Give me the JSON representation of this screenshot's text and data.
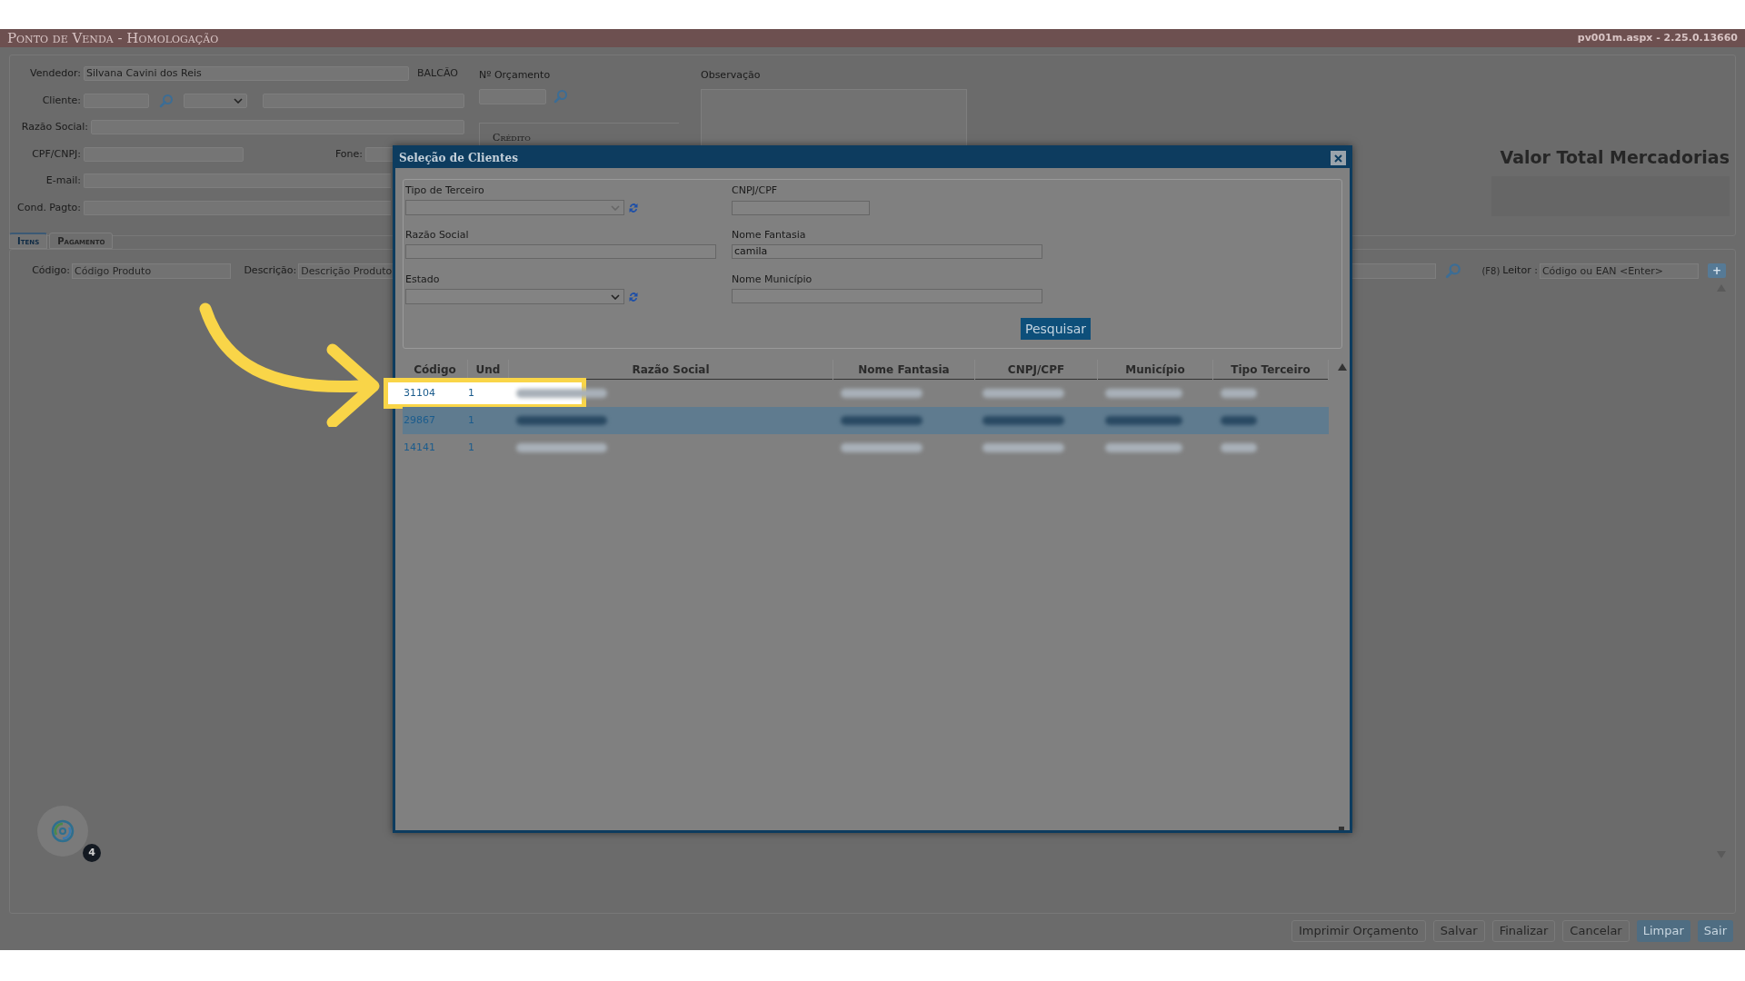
{
  "app_header": {
    "title": "Ponto de Venda  - Homologação",
    "version": "pv001m.aspx - 2.25.0.13660"
  },
  "order_form": {
    "vendedor_label": "Vendedor:",
    "vendedor_value": "Silvana Cavini dos Reis",
    "balcao": "BALCÃO",
    "cliente_label": "Cliente:",
    "razao_social_label": "Razão Social:",
    "cpf_label": "CPF/CNPJ:",
    "fone_label": "Fone:",
    "email_label": "E-mail:",
    "cond_pagto_label": "Cond. Pagto:",
    "orcamento_label": "Nº Orçamento",
    "credito_label": "Crédito",
    "observacao_label": "Observação"
  },
  "total": {
    "label": "Valor Total Mercadorias"
  },
  "tabs": [
    {
      "label": "Itens",
      "selected": true
    },
    {
      "label": "Pagamento",
      "selected": false
    }
  ],
  "item_entry": {
    "codigo_label": "Código:",
    "codigo_placeholder": "Código Produto",
    "descricao_label": "Descrição:",
    "descricao_placeholder": "Descrição Produto",
    "leitor_hint": "(F8)",
    "leitor_label": "Leitor :",
    "leitor_placeholder": "Código ou EAN <Enter>",
    "add_button": "+"
  },
  "actions": [
    {
      "label": "Imprimir Orçamento",
      "disabled": true
    },
    {
      "label": "Salvar",
      "disabled": true
    },
    {
      "label": "Finalizar",
      "disabled": true
    },
    {
      "label": "Cancelar",
      "disabled": true
    },
    {
      "label": "Limpar",
      "disabled": false
    },
    {
      "label": "Sair",
      "disabled": false
    }
  ],
  "help_badge": {
    "count": "4"
  },
  "dialog": {
    "title": "Seleção de Clientes",
    "filters": {
      "tipo_label": "Tipo de Terceiro",
      "cnpj_label": "CNPJ/CPF",
      "razao_label": "Razão Social",
      "fantasia_label": "Nome Fantasia",
      "fantasia_value": "camila",
      "estado_label": "Estado",
      "municipio_label": "Nome Município"
    },
    "search_button": "Pesquisar",
    "columns": [
      "Código",
      "Und",
      "Razão Social",
      "Nome Fantasia",
      "CNPJ/CPF",
      "Município",
      "Tipo Terceiro"
    ],
    "rows": [
      {
        "codigo": "31104",
        "und": "1",
        "selected": false,
        "highlighted": true
      },
      {
        "codigo": "29867",
        "und": "1",
        "selected": true,
        "highlighted": false
      },
      {
        "codigo": "14141",
        "und": "1",
        "selected": false,
        "highlighted": false
      }
    ]
  }
}
